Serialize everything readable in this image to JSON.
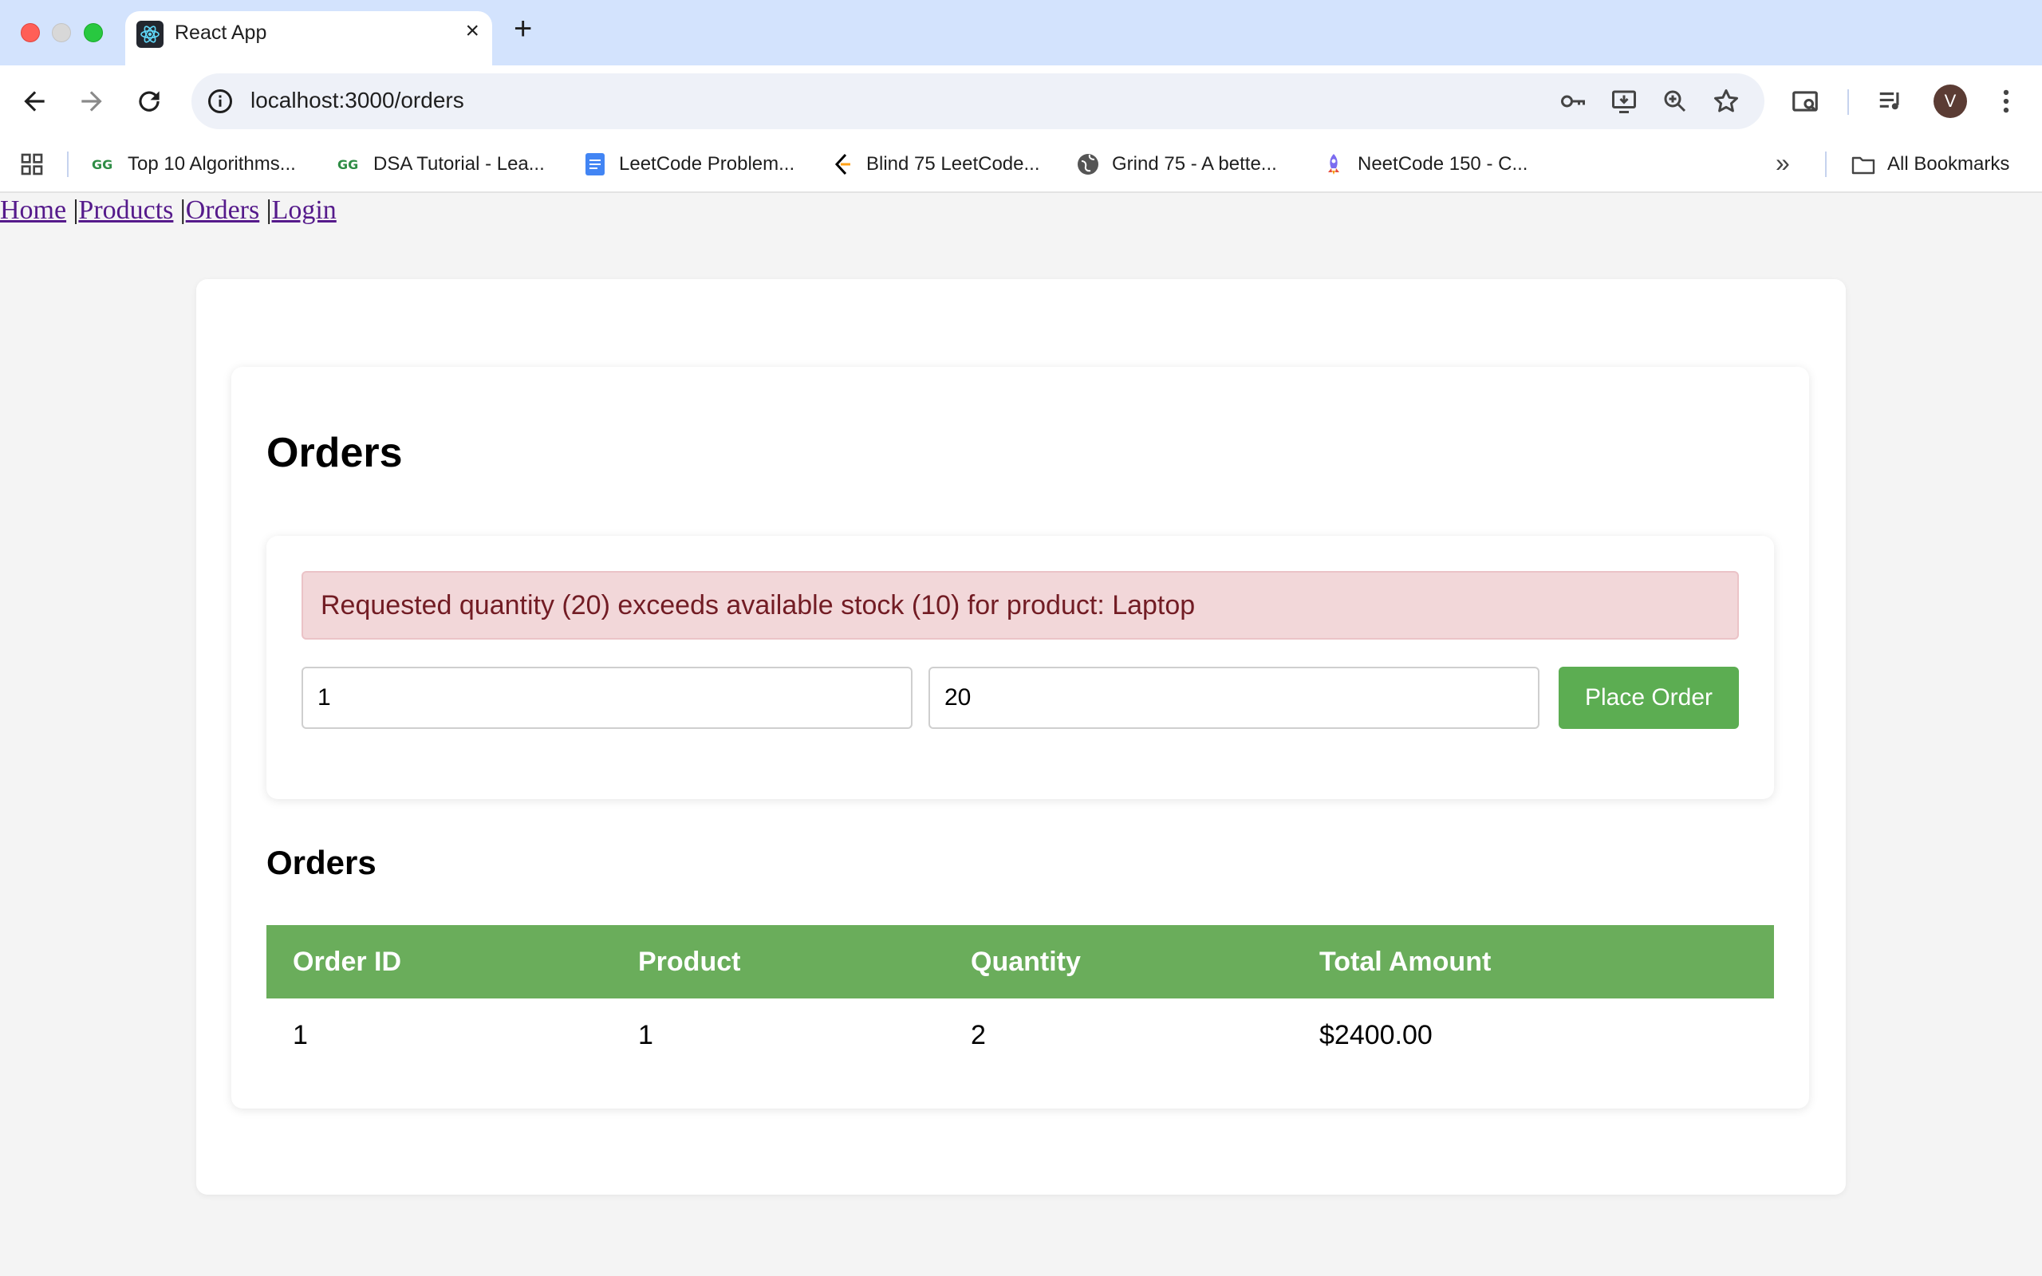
{
  "browser": {
    "tab_title": "React App",
    "tab_close": "×",
    "new_tab": "+",
    "url": "localhost:3000/orders",
    "avatar_letter": "V",
    "bookmarks": [
      {
        "label": "Top 10 Algorithms...",
        "icon": "geeksforgeeks-icon"
      },
      {
        "label": "DSA Tutorial - Lea...",
        "icon": "geeksforgeeks-icon"
      },
      {
        "label": "LeetCode Problem...",
        "icon": "google-docs-icon"
      },
      {
        "label": "Blind 75 LeetCode...",
        "icon": "leetcode-icon"
      },
      {
        "label": "Grind 75 - A bette...",
        "icon": "globe-icon"
      },
      {
        "label": "NeetCode 150 - C...",
        "icon": "rocket-icon"
      }
    ],
    "bookmarks_more": "»",
    "all_bookmarks": "All Bookmarks"
  },
  "nav": {
    "home": "Home",
    "products": "Products",
    "orders": "Orders",
    "login": "Login",
    "separator": "|"
  },
  "page": {
    "title": "Orders",
    "error_message": "Requested quantity (20) exceeds available stock (10) for product: Laptop",
    "product_value": "1",
    "quantity_value": "20",
    "place_order_label": "Place Order",
    "list_title": "Orders"
  },
  "table": {
    "headers": [
      "Order ID",
      "Product",
      "Quantity",
      "Total Amount"
    ],
    "rows": [
      [
        "1",
        "1",
        "2",
        "$2400.00"
      ]
    ]
  },
  "colors": {
    "accent_green": "#5cad52",
    "table_header": "#6aad5b",
    "alert_bg": "#f2d7d9",
    "alert_text": "#721c24"
  }
}
